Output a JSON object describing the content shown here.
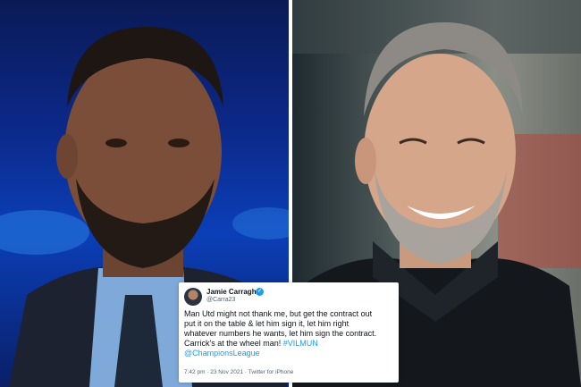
{
  "tweet": {
    "author_name": "Jamie Carragher",
    "author_handle": "@Carra23",
    "text_lines": [
      "Man Utd might not thank me, but get the contract out",
      "put it on the table & let him sign it, let him right",
      "whatever numbers he wants, let him sign the contract.",
      "Carrick's at the wheel man!"
    ],
    "hashtag": "#VILMUN",
    "mention": "@ChampionsLeague",
    "timestamp": "7:42 pm · 23 Nov 2021 · Twitter for iPhone"
  },
  "colors": {
    "link": "#1d9bf0",
    "left_background": "#0c2a8c",
    "right_background": "#6b6f6a"
  }
}
